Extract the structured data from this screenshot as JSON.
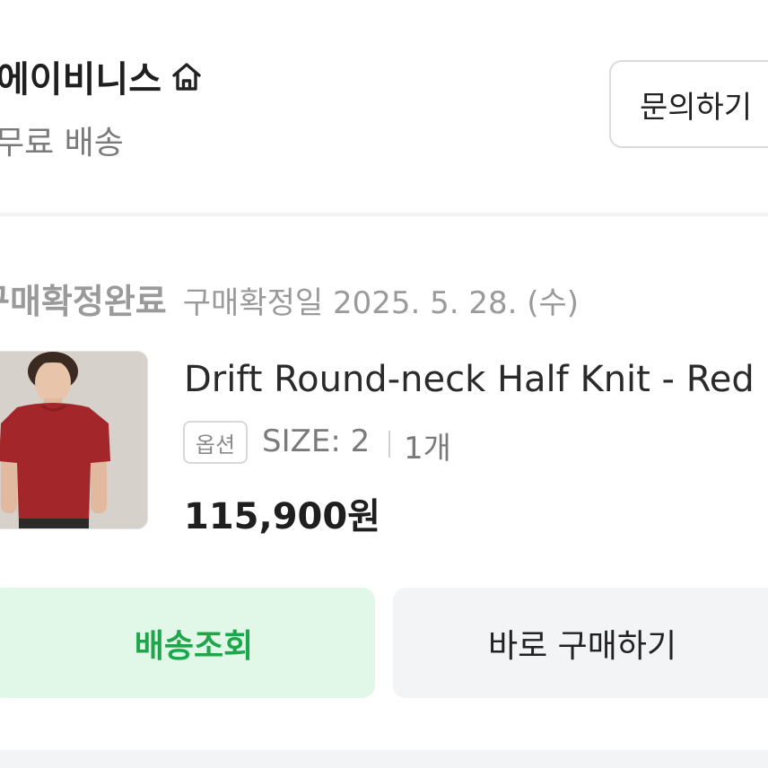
{
  "store": {
    "name": "에이비니스",
    "shipping": "무료 배송",
    "inquiry_label": "문의하기"
  },
  "order": {
    "status": "구매확정완료",
    "confirm_date": "구매확정일 2025. 5. 28. (수)"
  },
  "product": {
    "title": "Drift Round-neck Half Knit - Red",
    "option_badge": "옵션",
    "option_size": "SIZE: 2",
    "quantity": "1개",
    "price": "115,900원"
  },
  "actions": {
    "track_label": "배송조회",
    "buy_label": "바로 구매하기"
  },
  "colors": {
    "track_bg": "#e1f7e7",
    "track_text": "#1ea64a",
    "buy_bg": "#f3f4f6",
    "sweater": "#a3262a"
  },
  "icons": {
    "store_home": "home-icon"
  }
}
